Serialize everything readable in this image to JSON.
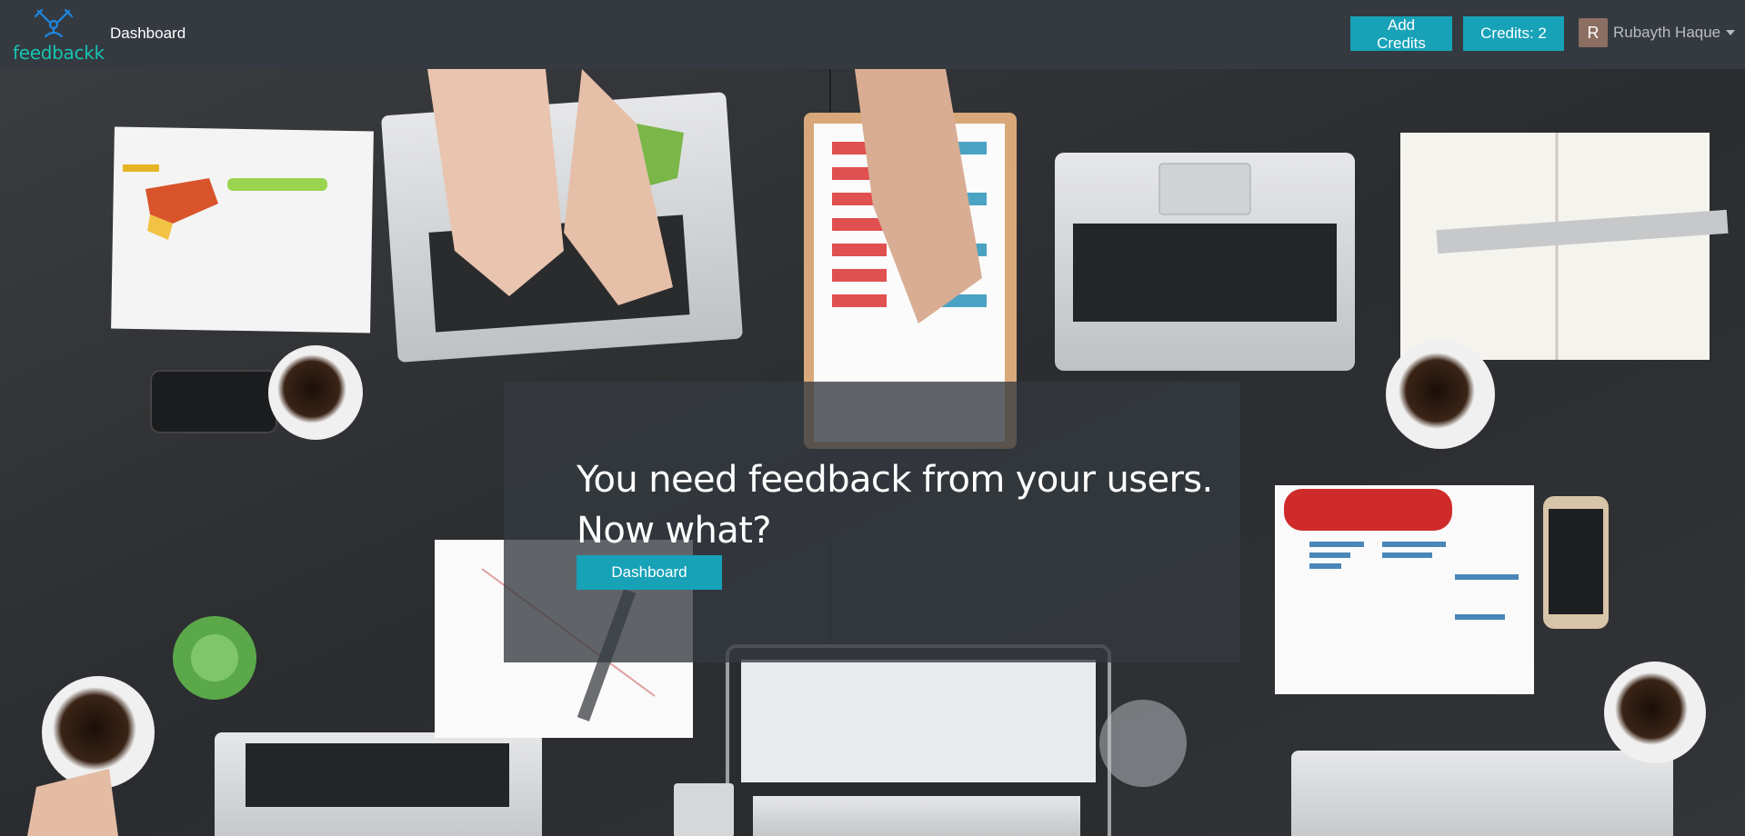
{
  "navbar": {
    "brand": "feedbackk",
    "dashboard_link": "Dashboard",
    "add_credits_label": "Add Credits",
    "credits_label": "Credits: 2",
    "user": {
      "avatar_initial": "R",
      "name": "Rubayth Haque"
    }
  },
  "hero": {
    "headline": "You need feedback from your users. Now what?",
    "cta_label": "Dashboard"
  },
  "colors": {
    "navbar_bg": "#343a40",
    "accent": "#17a2b8",
    "brand": "#17c3b2"
  }
}
